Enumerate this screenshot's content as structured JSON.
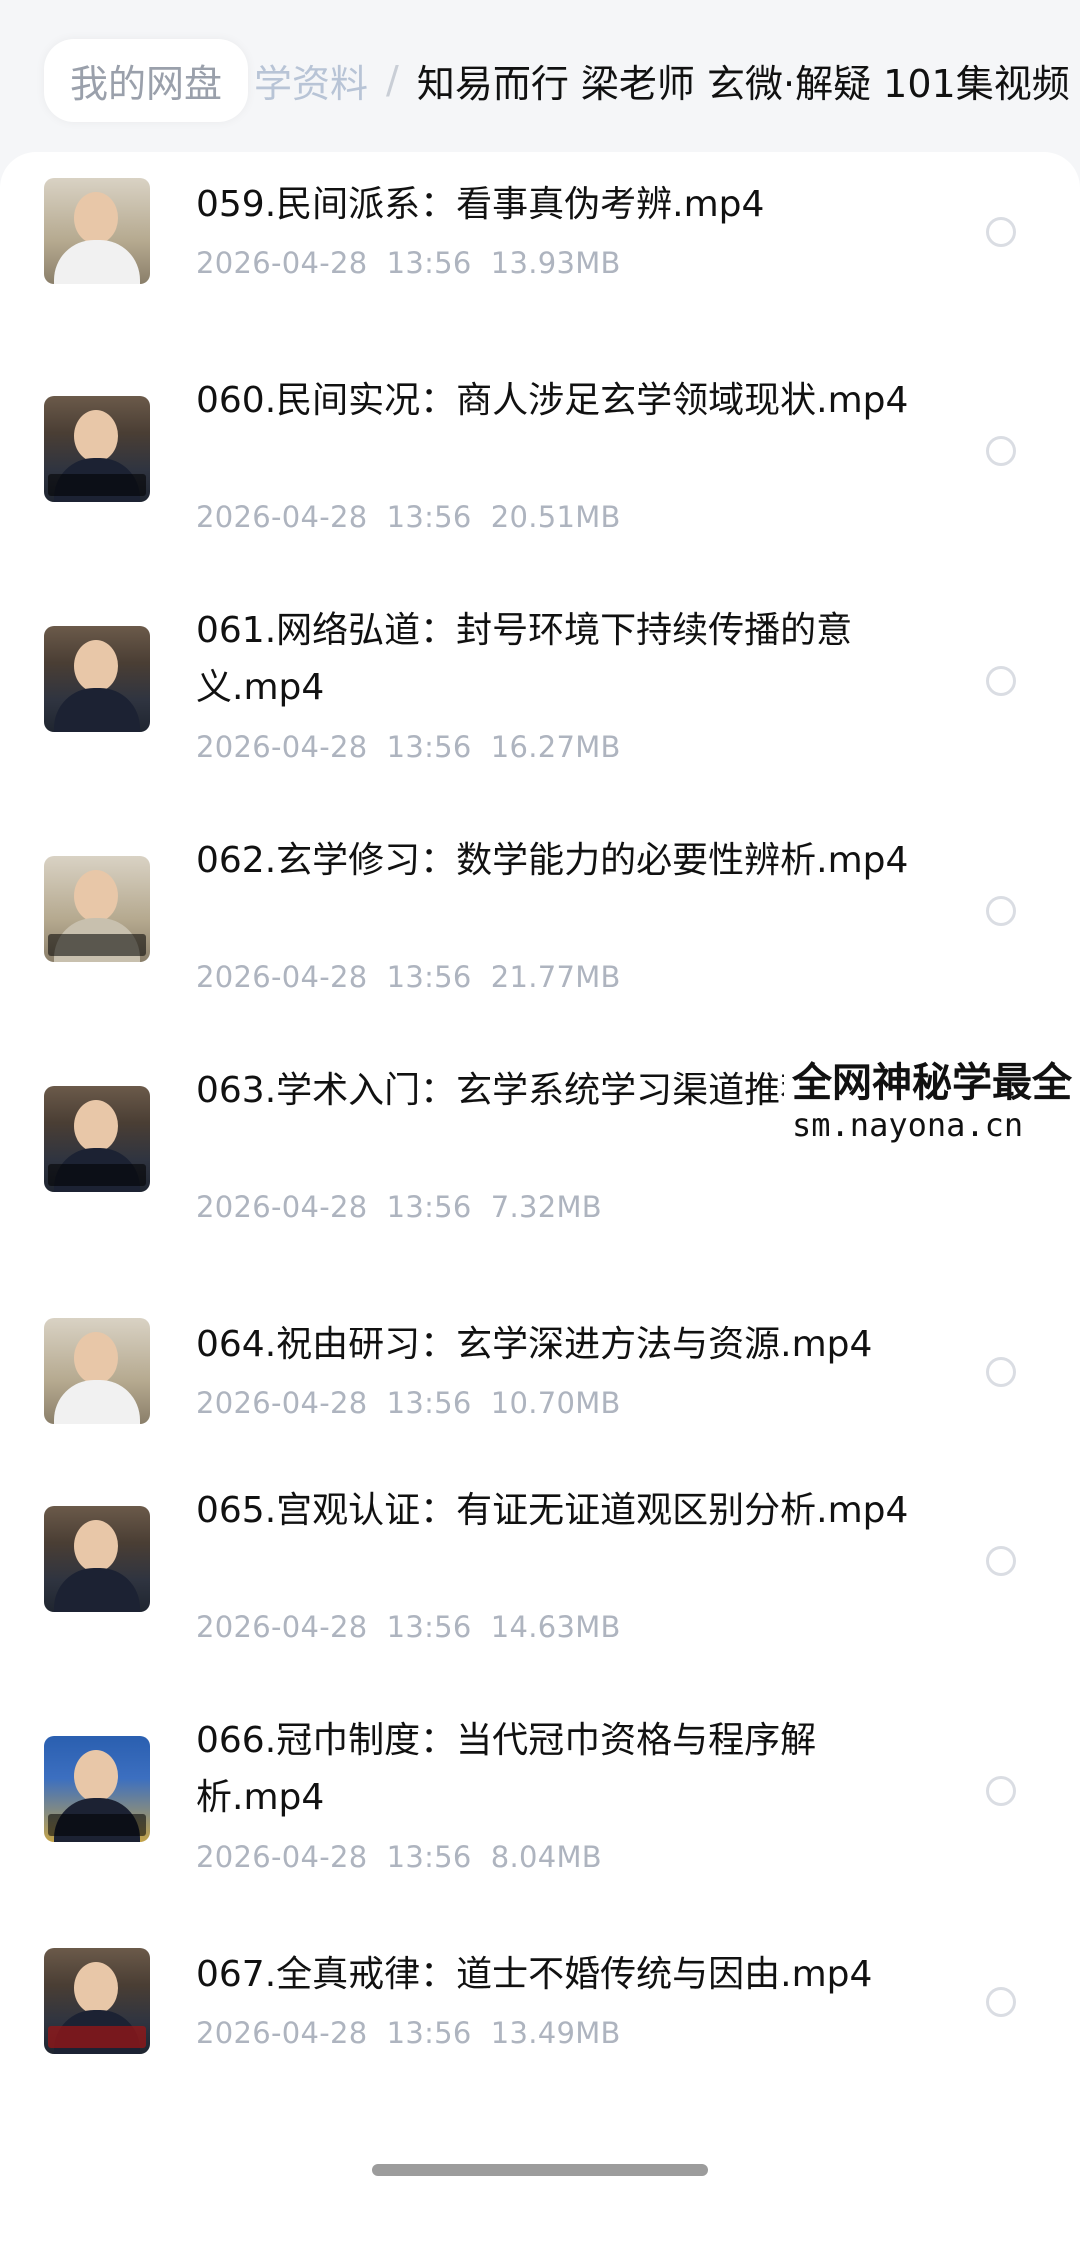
{
  "breadcrumb": {
    "root": "我的网盘",
    "middle": "学资料",
    "separator": "/",
    "current": "知易而行 梁老师 玄微·解疑 101集视频"
  },
  "files": [
    {
      "name": "059.民间派系：看事真伪考辨.mp4",
      "date": "2026-04-28",
      "time": "13:56",
      "size": "13.93MB"
    },
    {
      "name": "060.民间实况：商人涉足玄学领域现状.mp4",
      "date": "2026-04-28",
      "time": "13:56",
      "size": "20.51MB"
    },
    {
      "name": "061.网络弘道：封号环境下持续传播的意义.mp4",
      "date": "2026-04-28",
      "time": "13:56",
      "size": "16.27MB"
    },
    {
      "name": "062.玄学修习：数学能力的必要性辨析.mp4",
      "date": "2026-04-28",
      "time": "13:56",
      "size": "21.77MB"
    },
    {
      "name": "063.学术入门：玄学系统学习渠道推荐.mp4",
      "date": "2026-04-28",
      "time": "13:56",
      "size": "7.32MB"
    },
    {
      "name": "064.祝由研习：玄学深进方法与资源.mp4",
      "date": "2026-04-28",
      "time": "13:56",
      "size": "10.70MB"
    },
    {
      "name": "065.宫观认证：有证无证道观区别分析.mp4",
      "date": "2026-04-28",
      "time": "13:56",
      "size": "14.63MB"
    },
    {
      "name": "066.冠巾制度：当代冠巾资格与程序解析.mp4",
      "date": "2026-04-28",
      "time": "13:56",
      "size": "8.04MB"
    },
    {
      "name": "067.全真戒律：道士不婚传统与因由.mp4",
      "date": "2026-04-28",
      "time": "13:56",
      "size": "13.49MB"
    }
  ],
  "watermark": {
    "line1": "全网神秘学最全",
    "line2": "sm.nayona.cn"
  },
  "icons": {
    "thumbnail": "video-thumbnail-icon",
    "select": "radio-unchecked-icon"
  }
}
